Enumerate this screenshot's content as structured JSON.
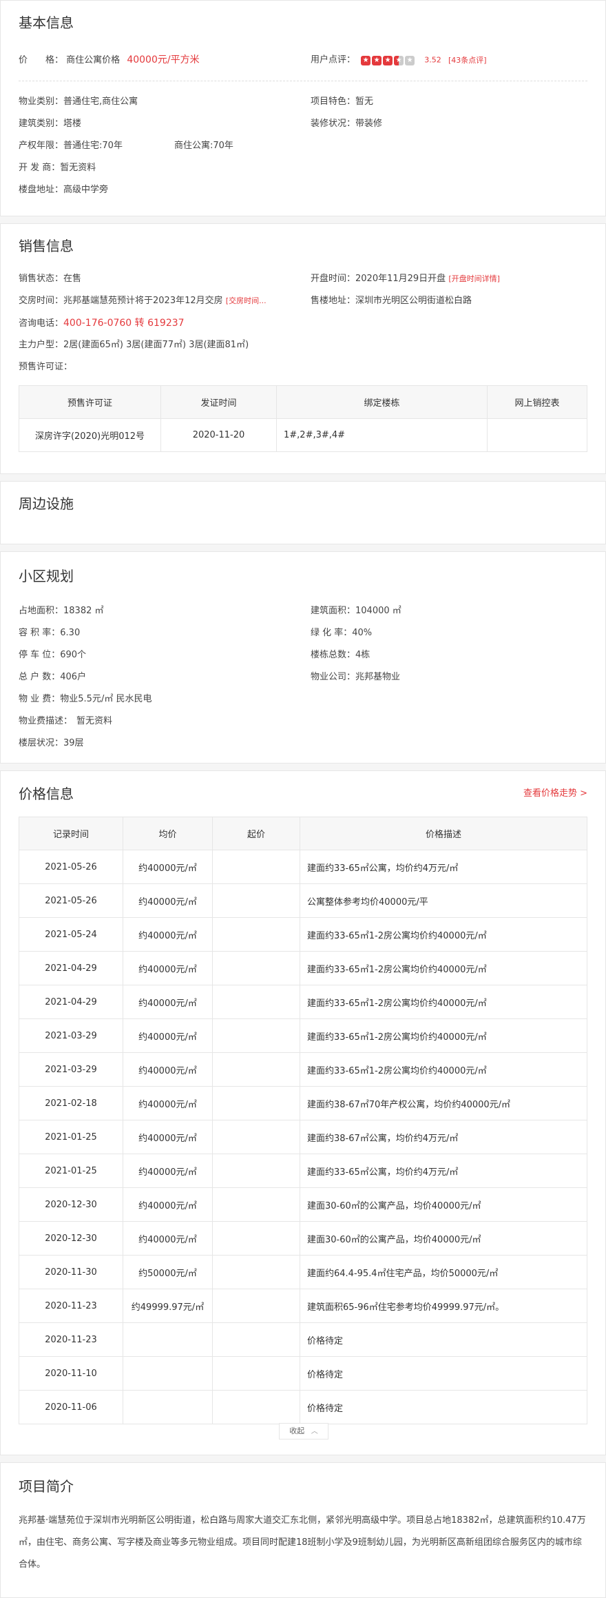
{
  "basic": {
    "title": "基本信息",
    "price_label": "价　　格：",
    "price_type": "商住公寓价格",
    "price_value": "40000元/平方米",
    "rating_label": "用户点评：",
    "rating_score": "3.52",
    "rating_count": "[43条点评]",
    "rating_stars": 3.5,
    "prop_type_label": "物业类别：",
    "prop_type": "普通住宅,商住公寓",
    "feature_label": "项目特色：",
    "feature": "暂无",
    "build_type_label": "建筑类别：",
    "build_type": "塔楼",
    "decor_label": "装修状况：",
    "decor": "带装修",
    "term_label": "产权年限：",
    "term_1": "普通住宅:70年",
    "term_2": "商住公寓:70年",
    "dev_label": "开 发 商：",
    "dev": "暂无资料",
    "addr_label": "楼盘地址：",
    "addr": "高级中学旁"
  },
  "sales": {
    "title": "销售信息",
    "status_label": "销售状态：",
    "status": "在售",
    "open_label": "开盘时间：",
    "open": "2020年11月29日开盘",
    "open_link": "[开盘时间详情]",
    "deliver_label": "交房时间：",
    "deliver": "兆邦基端慧苑预计将于2023年12月交房",
    "deliver_link": "[交房时间...",
    "office_label": "售楼地址：",
    "office": "深圳市光明区公明街道松白路",
    "phone_label": "咨询电话：",
    "phone": "400-176-0760 转 619237",
    "units_label": "主力户型：",
    "units": "2居(建面65㎡) 3居(建面77㎡) 3居(建面81㎡)",
    "permit_label": "预售许可证：",
    "permit_headers": [
      "预售许可证",
      "发证时间",
      "绑定楼栋",
      "网上销控表"
    ],
    "permit_rows": [
      {
        "no": "深房许字(2020)光明012号",
        "date": "2020-11-20",
        "bld": "1#,2#,3#,4#",
        "ctrl": ""
      }
    ]
  },
  "nearby": {
    "title": "周边设施"
  },
  "plan": {
    "title": "小区规划",
    "land_label": "占地面积：",
    "land": "18382 ㎡",
    "area_label": "建筑面积：",
    "area": "104000 ㎡",
    "far_label": "容 积 率：",
    "far": "6.30",
    "green_label": "绿 化 率：",
    "green": "40%",
    "park_label": "停 车 位：",
    "park": "690个",
    "bld_label": "楼栋总数：",
    "bld": "4栋",
    "hh_label": "总 户 数：",
    "hh": "406户",
    "mgmt_label": "物业公司：",
    "mgmt": "兆邦基物业",
    "fee_label": "物 业 费：",
    "fee": "物业5.5元/㎡ 民水民电",
    "fee_desc_label": "物业费描述：",
    "fee_desc": "暂无资料",
    "floor_label": "楼层状况：",
    "floor": "39层"
  },
  "price": {
    "title": "价格信息",
    "trend_link": "查看价格走势 >",
    "headers": [
      "记录时间",
      "均价",
      "起价",
      "价格描述"
    ],
    "rows": [
      {
        "date": "2021-05-26",
        "avg": "约40000元/㎡",
        "start": "",
        "desc": "建面约33-65㎡公寓，均价约4万元/㎡"
      },
      {
        "date": "2021-05-26",
        "avg": "约40000元/㎡",
        "start": "",
        "desc": "公寓整体参考均价40000元/平"
      },
      {
        "date": "2021-05-24",
        "avg": "约40000元/㎡",
        "start": "",
        "desc": "建面约33-65㎡1-2房公寓均价约40000元/㎡"
      },
      {
        "date": "2021-04-29",
        "avg": "约40000元/㎡",
        "start": "",
        "desc": "建面约33-65㎡1-2房公寓均价约40000元/㎡"
      },
      {
        "date": "2021-04-29",
        "avg": "约40000元/㎡",
        "start": "",
        "desc": "建面约33-65㎡1-2房公寓均价约40000元/㎡"
      },
      {
        "date": "2021-03-29",
        "avg": "约40000元/㎡",
        "start": "",
        "desc": "建面约33-65㎡1-2房公寓均价约40000元/㎡"
      },
      {
        "date": "2021-03-29",
        "avg": "约40000元/㎡",
        "start": "",
        "desc": "建面约33-65㎡1-2房公寓均价约40000元/㎡"
      },
      {
        "date": "2021-02-18",
        "avg": "约40000元/㎡",
        "start": "",
        "desc": "建面约38-67㎡70年产权公寓，均价约40000元/㎡"
      },
      {
        "date": "2021-01-25",
        "avg": "约40000元/㎡",
        "start": "",
        "desc": "建面约38-67㎡公寓，均价约4万元/㎡"
      },
      {
        "date": "2021-01-25",
        "avg": "约40000元/㎡",
        "start": "",
        "desc": "建面约33-65㎡公寓，均价约4万元/㎡"
      },
      {
        "date": "2020-12-30",
        "avg": "约40000元/㎡",
        "start": "",
        "desc": "建面30-60㎡的公寓产品，均价40000元/㎡"
      },
      {
        "date": "2020-12-30",
        "avg": "约40000元/㎡",
        "start": "",
        "desc": "建面30-60㎡的公寓产品，均价40000元/㎡"
      },
      {
        "date": "2020-11-30",
        "avg": "约50000元/㎡",
        "start": "",
        "desc": "建面约64.4-95.4㎡住宅产品，均价50000元/㎡"
      },
      {
        "date": "2020-11-23",
        "avg": "约49999.97元/㎡",
        "start": "",
        "desc": "建筑面积65-96㎡住宅参考均价49999.97元/㎡。"
      },
      {
        "date": "2020-11-23",
        "avg": "",
        "start": "",
        "desc": "价格待定"
      },
      {
        "date": "2020-11-10",
        "avg": "",
        "start": "",
        "desc": "价格待定"
      },
      {
        "date": "2020-11-06",
        "avg": "",
        "start": "",
        "desc": "价格待定"
      }
    ],
    "collapse_label": "收起",
    "collapse_icon": "chevron-up-icon"
  },
  "intro": {
    "title": "项目简介",
    "text": "兆邦基·端慧苑位于深圳市光明新区公明街道，松白路与周家大道交汇东北侧，紧邻光明高级中学。项目总占地18382㎡，总建筑面积约10.47万㎡，由住宅、商务公寓、写字楼及商业等多元物业组成。项目同时配建18班制小学及9班制幼儿园，为光明新区高新组团综合服务区内的城市综合体。"
  }
}
